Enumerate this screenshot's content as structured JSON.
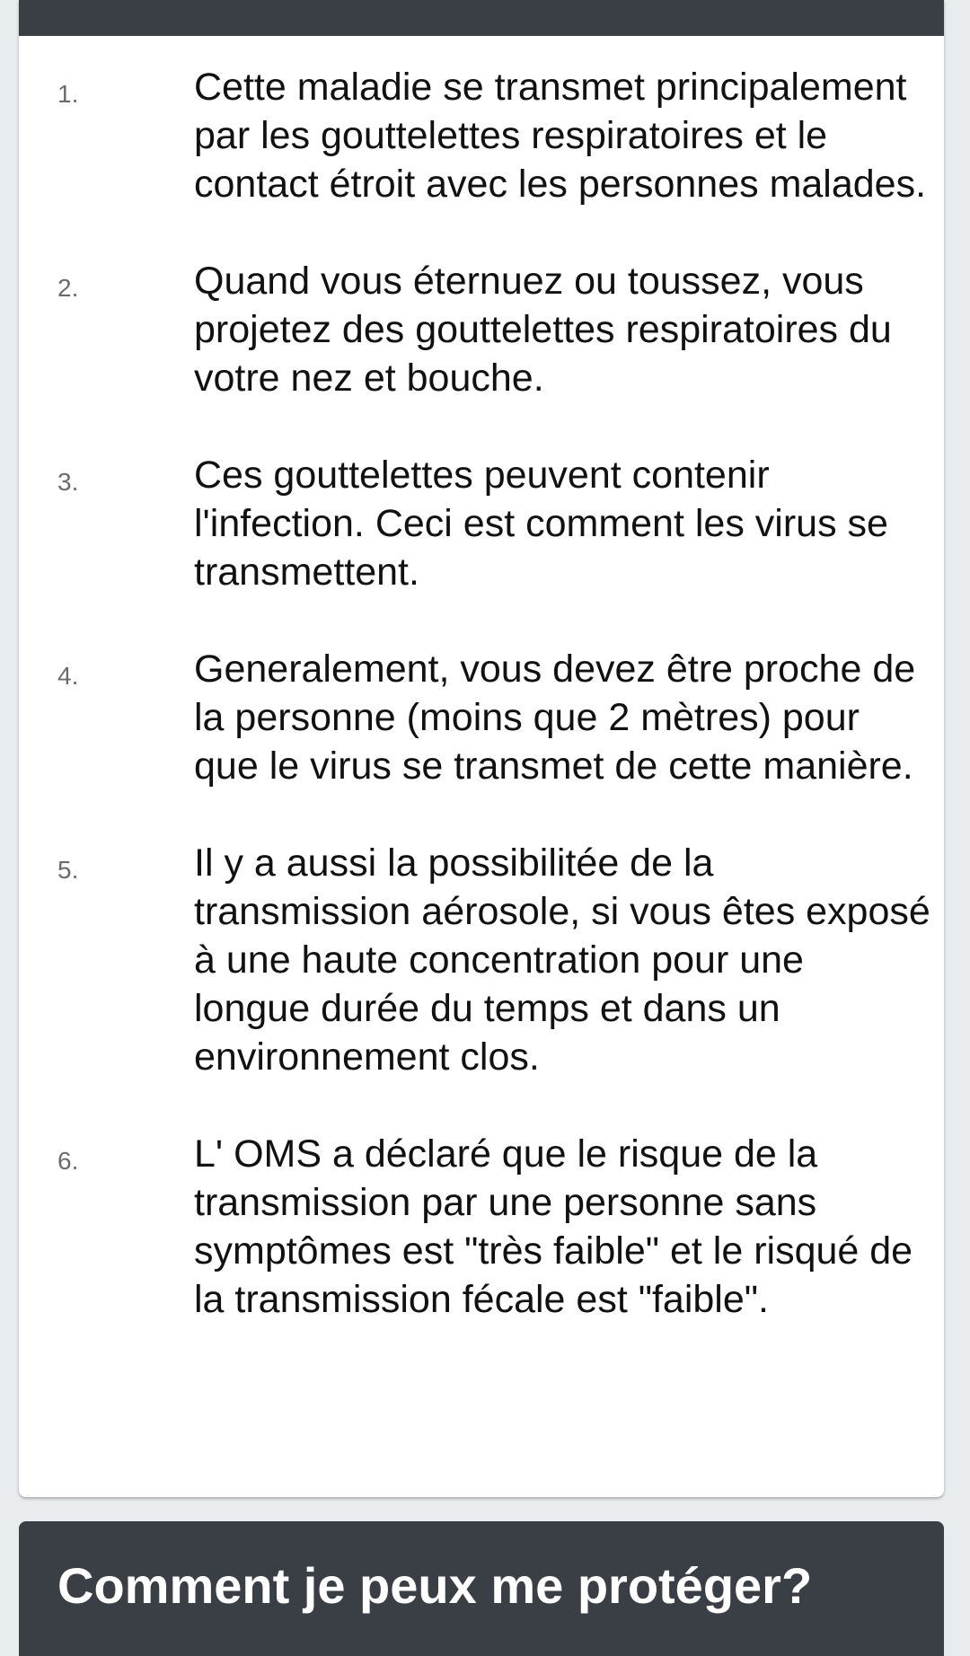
{
  "transmission_list": {
    "items": [
      {
        "number": "1.",
        "text": "Cette maladie se transmet principalement par les gouttelettes respiratoires et le contact étroit avec les personnes malades."
      },
      {
        "number": "2.",
        "text": "Quand vous éternuez ou toussez, vous projetez des gouttelettes respiratoires du votre nez et bouche."
      },
      {
        "number": "3.",
        "text": "Ces gouttelettes peuvent contenir l'infection. Ceci est comment les virus se transmettent."
      },
      {
        "number": "4.",
        "text": "Generalement, vous devez être proche de la personne (moins que 2 mètres) pour que le virus se transmet de cette manière."
      },
      {
        "number": "5.",
        "text": "Il y a aussi la possibilitée de la transmission aérosole, si vous êtes exposé à une haute concentration pour une longue durée du temps et dans un environnement clos."
      },
      {
        "number": "6.",
        "text": "L' OMS a déclaré que le risque de la transmission par une personne sans symptômes est \"très faible\" et le risqué de la transmission fécale est \"faible\"."
      }
    ]
  },
  "next_section": {
    "title": "Comment je peux me protéger?"
  },
  "colors": {
    "header_bg": "#3a3f46",
    "page_bg": "#e9ecee",
    "card_bg": "#ffffff"
  }
}
